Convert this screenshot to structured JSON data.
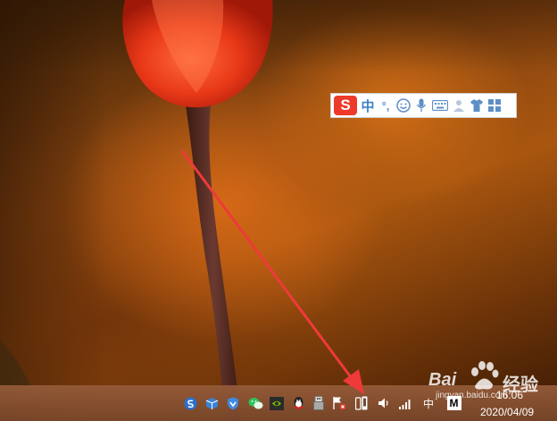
{
  "ime_toolbar": {
    "logo": "S",
    "items": [
      {
        "label": "中",
        "icon": "input-mode-chinese"
      },
      {
        "label": "°,",
        "icon": "punctuation-mode"
      },
      {
        "label": "",
        "icon": "emoji-smile-icon"
      },
      {
        "label": "",
        "icon": "microphone-icon"
      },
      {
        "label": "",
        "icon": "keyboard-icon"
      },
      {
        "label": "",
        "icon": "user-toolbox-icon"
      },
      {
        "label": "",
        "icon": "skin-shirt-icon"
      },
      {
        "label": "",
        "icon": "grid-menu-icon"
      }
    ]
  },
  "taskbar": {
    "tray_icons": [
      "sogou-icon",
      "package-icon",
      "shield-icon",
      "wechat-icon",
      "nvidia-icon",
      "qq-icon",
      "usb-device-icon",
      "action-center-flag-icon",
      "phone-manager-icon",
      "volume-icon",
      "network-signal-icon"
    ],
    "ime_indicator": "中",
    "ime_mode_box": "M",
    "clock_time": "16:06",
    "clock_date": "2020/04/09"
  },
  "watermark": {
    "brand_a": "Bai",
    "brand_b": "经验",
    "url": "jingyan.baidu.com"
  },
  "annotation": {
    "color": "#ee3a3a"
  }
}
